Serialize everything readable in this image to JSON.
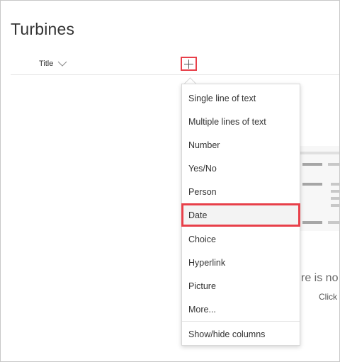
{
  "list": {
    "title": "Turbines",
    "columns": [
      {
        "label": "Title"
      }
    ],
    "add_column_icon": "plus-icon"
  },
  "menu": {
    "items": [
      {
        "label": "Single line of text"
      },
      {
        "label": "Multiple lines of text"
      },
      {
        "label": "Number"
      },
      {
        "label": "Yes/No"
      },
      {
        "label": "Person"
      },
      {
        "label": "Date",
        "selected": true
      },
      {
        "label": "Choice"
      },
      {
        "label": "Hyperlink"
      },
      {
        "label": "Picture"
      },
      {
        "label": "More..."
      }
    ],
    "footer": {
      "label": "Show/hide columns"
    }
  },
  "empty_state": {
    "message_partial": "re is no",
    "hint_partial": "Click"
  },
  "colors": {
    "highlight_border": "#e8404a",
    "text": "#333333",
    "divider": "#e6e6e6"
  }
}
